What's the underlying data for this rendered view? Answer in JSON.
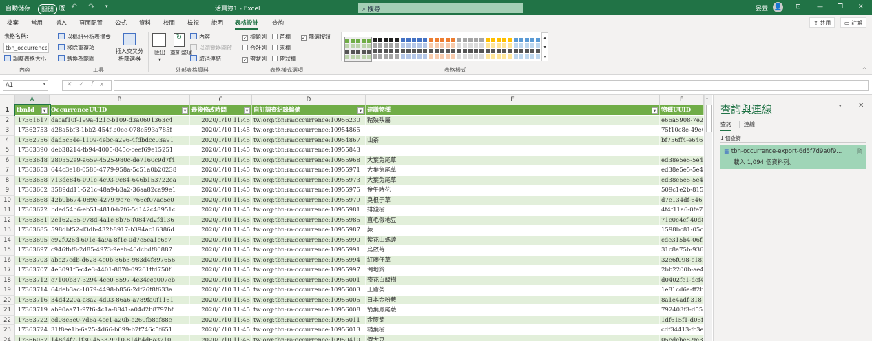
{
  "titlebar": {
    "autosave_label": "自動儲存",
    "autosave_state": "關閉",
    "title": "活頁簿1 - Excel",
    "search_placeholder": "搜尋",
    "user": "晏萱"
  },
  "tabs": [
    "檔案",
    "常用",
    "插入",
    "頁面配置",
    "公式",
    "資料",
    "校閱",
    "檢視",
    "說明",
    "表格設計",
    "查詢"
  ],
  "active_tab": "表格設計",
  "top_buttons": {
    "share": "共用",
    "comments": "註解"
  },
  "ribbon": {
    "properties": {
      "table_name_label": "表格名稱:",
      "table_name_value": "tbn_occurrence_e",
      "resize": "調整表格大小",
      "group": "內容"
    },
    "tools": {
      "pivot": "以樞紐分析表摘要",
      "remove_dup": "移除重複項",
      "convert": "轉換為範圍",
      "slicer": "插入交叉分析篩選器",
      "group": "工具"
    },
    "external": {
      "export": "匯出",
      "refresh": "重新整理",
      "properties": "內容",
      "open_browser": "以瀏覽器開啟",
      "unlink": "取消連結",
      "group": "外部表格資料"
    },
    "style_options": {
      "header_row": "標題列",
      "total_row": "合計列",
      "banded_rows": "帶狀列",
      "first_col": "首欄",
      "last_col": "末欄",
      "banded_cols": "帶狀欄",
      "filter_btn": "篩選按鈕",
      "group": "表格樣式選項",
      "checked": {
        "header_row": true,
        "total_row": false,
        "banded_rows": true,
        "first_col": false,
        "last_col": false,
        "banded_cols": false,
        "filter_btn": true
      }
    },
    "styles": {
      "group": "表格樣式",
      "colors": [
        "#70ad47",
        "#222222",
        "#4472c4",
        "#ed7d31",
        "#a5a5a5",
        "#ffc000",
        "#5b9bd5"
      ]
    }
  },
  "formula_bar": {
    "name_box": "A1",
    "formula": ""
  },
  "columns": [
    "A",
    "B",
    "C",
    "D",
    "E",
    "F"
  ],
  "table": {
    "headers": [
      "tbnId",
      "OccurrenceUUID",
      "最後修改時間",
      "自訂調查紀錄編號",
      "建議物種",
      "物種UUID"
    ],
    "rows": [
      [
        "17361617",
        "dacaf10f-199a-421c-b109-d3a0601363c4",
        "2020/1/10 11:45",
        "tw:org:tbn:ra:occurrence:10956230",
        "豬殃殃屬",
        "e66a5908-7e2"
      ],
      [
        "17362753",
        "d28a5bf3-1bb2-454f-b0ec-078e593a785f",
        "2020/1/10 11:45",
        "tw:org:tbn:ra:occurrence:10954865",
        "",
        "75f10c8e-49e0"
      ],
      [
        "17362756",
        "dad5c54e-1109-4ebc-a296-4fdbdcc03a91",
        "2020/1/10 11:45",
        "tw:org:tbn:ra:occurrence:10954867",
        "山茶",
        "bf756ff4-e646"
      ],
      [
        "17363390",
        "deb38214-fb94-4005-845c-ceef69e15251",
        "2020/1/10 11:45",
        "tw:org:tbn:ra:occurrence:10955843",
        "",
        ""
      ],
      [
        "17363648",
        "280352e9-a659-4525-980c-de7160c9d7f4",
        "2020/1/10 11:45",
        "tw:org:tbn:ra:occurrence:10955968",
        "大葉兔尾草",
        "ed38e5e5-5e4e"
      ],
      [
        "17363653",
        "644c3e18-0586-4779-958a-5c51a0b20238",
        "2020/1/10 11:45",
        "tw:org:tbn:ra:occurrence:10955971",
        "大葉兔尾草",
        "ed38e5e5-5e4e"
      ],
      [
        "17363658",
        "713de846-091e-4c93-9c84-646b153722ea",
        "2020/1/10 11:45",
        "tw:org:tbn:ra:occurrence:10955973",
        "大葉兔尾草",
        "ed38e5e5-5e4e"
      ],
      [
        "17363662",
        "3589dd11-521c-48a9-b3a2-36aa82ca99e1",
        "2020/1/10 11:45",
        "tw:org:tbn:ra:occurrence:10955975",
        "金午時花",
        "509c1e2b-815"
      ],
      [
        "17363668",
        "42b9b674-089e-4279-9c7e-766cf07ac5c0",
        "2020/1/10 11:45",
        "tw:org:tbn:ra:occurrence:10955979",
        "臭根子草",
        "d7e134df-6460"
      ],
      [
        "17363672",
        "bded54b6-eb51-4810-b7f6-5d142c48951c",
        "2020/1/10 11:45",
        "tw:org:tbn:ra:occurrence:10955981",
        "排錢樹",
        "4f4f11a6-0fe7"
      ],
      [
        "17363681",
        "2e162255-978d-4a1c-8b75-f0847d2fd136",
        "2020/1/10 11:45",
        "tw:org:tbn:ra:occurrence:10955985",
        "直毛假地豆",
        "71c0e4cf-40d8"
      ],
      [
        "17363685",
        "598dbf52-d3db-432f-8917-b394ac16386d",
        "2020/1/10 11:45",
        "tw:org:tbn:ra:occurrence:10955987",
        "蕨",
        "1598bc81-05c"
      ],
      [
        "17363695",
        "e92f026d-601c-4a9a-8f1c-0d7c5ca1c6e7",
        "2020/1/10 11:45",
        "tw:org:tbn:ra:occurrence:10955990",
        "紫花山螞蝗",
        "cde315b4-06f2"
      ],
      [
        "17363697",
        "c946fbf8-2d85-4973-9eeb-40dcbdf80887",
        "2020/1/10 11:45",
        "tw:org:tbn:ra:occurrence:10955991",
        "烏斂莓",
        "31c8a75b-936"
      ],
      [
        "17363703",
        "abc27cdb-d628-4c0b-86b3-983d4f897656",
        "2020/1/10 11:45",
        "tw:org:tbn:ra:occurrence:10955994",
        "紅藤仔草",
        "32e6f098-c182"
      ],
      [
        "17363707",
        "4e3091f5-c4e3-4401-8070-09261ffd750f",
        "2020/1/10 11:45",
        "tw:org:tbn:ra:occurrence:10955997",
        "倒地鈴",
        "2bb2200b-ae4"
      ],
      [
        "17363712",
        "c7100b37-3294-4ce0-8597-4c34cca007cb",
        "2020/1/10 11:45",
        "tw:org:tbn:ra:occurrence:10956001",
        "密花白飯樹",
        "d0402fe1-dcf4"
      ],
      [
        "17363714",
        "64deb3ac-1079-4498-b856-2df26f8f633a",
        "2020/1/10 11:45",
        "tw:org:tbn:ra:occurrence:10956003",
        "王爺葵",
        "1e81cd6a-ff2b"
      ],
      [
        "17363716",
        "34d4220a-a8a2-4d03-86a6-a789fa0f1161",
        "2020/1/10 11:45",
        "tw:org:tbn:ra:occurrence:10956005",
        "日本金粉蕨",
        "8a1e4adf-318"
      ],
      [
        "17363719",
        "ab90aa71-97f6-4c1a-8841-a04d2b8797bf",
        "2020/1/10 11:45",
        "tw:org:tbn:ra:occurrence:10956008",
        "箭葉鳳尾蕨",
        "792403f3-d55"
      ],
      [
        "17363722",
        "ed08c5e0-7d6a-4cc1-a20b-e260fb8af88c",
        "2020/1/10 11:45",
        "tw:org:tbn:ra:occurrence:10956011",
        "金腰箭",
        "1df615f1-d05f"
      ],
      [
        "17363724",
        "31f8ee1b-6a25-4d66-b699-b7f746c5f651",
        "2020/1/10 11:45",
        "tw:org:tbn:ra:occurrence:10956013",
        "糙葉樹",
        "cdf34413-fc3e"
      ],
      [
        "17366057",
        "148d4f7-1f30-4533-9910-814b4d6a3710",
        "2020/1/10 11:45",
        "tw:org:tbn:ra:occurrence:10950410",
        "假大豆",
        "05edcbe8-9e30"
      ]
    ]
  },
  "query_pane": {
    "title": "查詢與連線",
    "tab_queries": "查詢",
    "tab_connections": "連線",
    "count": "1 個查詢",
    "query_name": "tbn-occurrence-export-6d5f7d9a0f9...",
    "query_status": "載入 1,094 個資料列。"
  }
}
